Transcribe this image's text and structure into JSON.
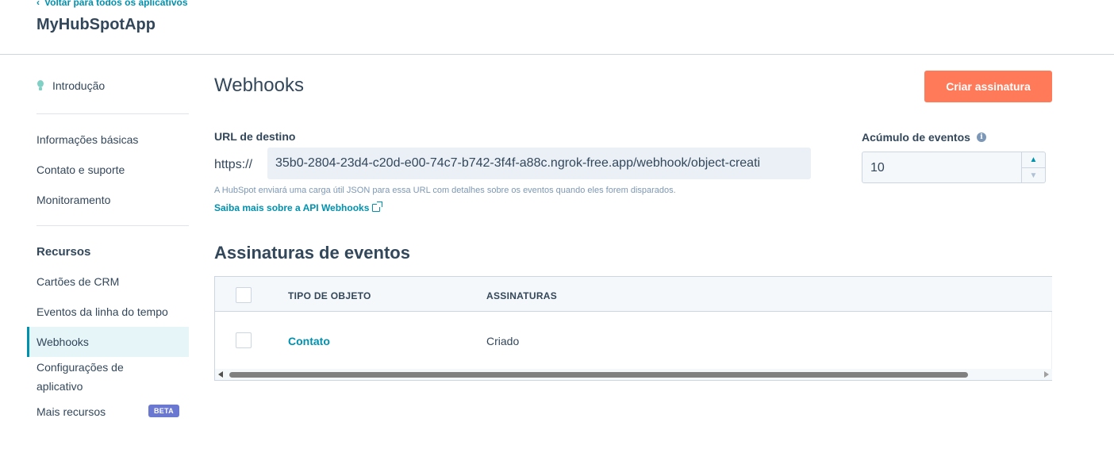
{
  "header": {
    "back_link": "Voltar para todos os aplicativos",
    "app_title": "MyHubSpotApp"
  },
  "sidebar": {
    "intro": "Introdução",
    "items_top": [
      "Informações básicas",
      "Contato e suporte",
      "Monitoramento"
    ],
    "section_title": "Recursos",
    "items_resources": [
      "Cartões de CRM",
      "Eventos da linha do tempo",
      "Webhooks",
      "Configurações de aplicativo",
      "Mais recursos"
    ],
    "active_item": "Webhooks",
    "beta_badge": "BETA"
  },
  "main": {
    "title": "Webhooks",
    "create_button": "Criar assinatura",
    "url": {
      "label": "URL de destino",
      "prefix": "https://",
      "value": "35b0-2804-23d4-c20d-e00-74c7-b742-3f4f-a88c.ngrok-free.app/webhook/object-creati",
      "help": "A HubSpot enviará uma carga útil JSON para essa URL com detalhes sobre os eventos quando eles forem disparados.",
      "learn_more": "Saiba mais sobre a API Webhooks"
    },
    "accumulation": {
      "label": "Acúmulo de eventos",
      "value": "10"
    },
    "subscriptions": {
      "title": "Assinaturas de eventos",
      "columns": [
        "TIPO DE OBJETO",
        "ASSINATURAS"
      ],
      "rows": [
        {
          "object_type": "Contato",
          "subscriptions": "Criado"
        }
      ]
    }
  },
  "colors": {
    "accent": "#0091ae",
    "primary_button": "#ff7a59",
    "text": "#33475b",
    "beta": "#6a78d1"
  }
}
